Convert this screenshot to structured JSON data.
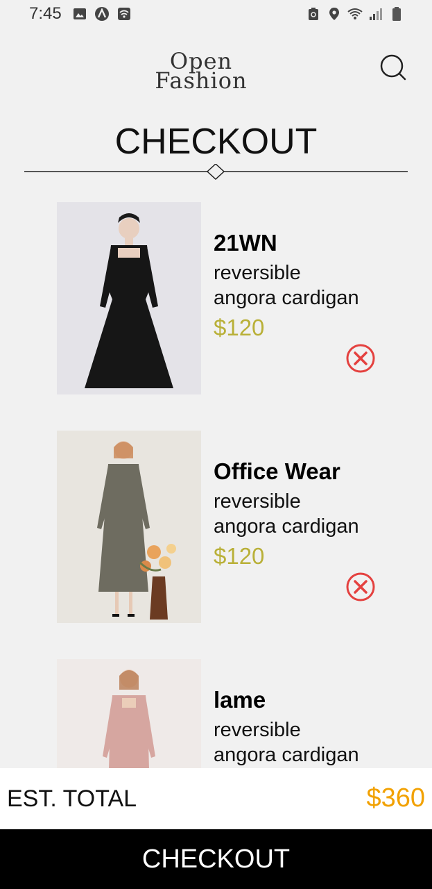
{
  "status_bar": {
    "time": "7:45",
    "left_icons": [
      "image-icon",
      "a-circle-icon",
      "wifi-box-icon"
    ],
    "right_icons": [
      "recycle-icon",
      "location-icon",
      "wifi-icon",
      "signal-icon",
      "battery-icon"
    ]
  },
  "header": {
    "logo_line1": "Open",
    "logo_line2": "Fashion",
    "search_icon": "search-icon"
  },
  "page": {
    "title": "CHECKOUT"
  },
  "items": [
    {
      "brand": "21WN",
      "desc_line1": "reversible",
      "desc_line2": "angora cardigan",
      "price": "$120",
      "remove_icon": "close-circle-icon",
      "dress_color": "#161616",
      "bg_color": "#e4e3e8"
    },
    {
      "brand": "Office Wear",
      "desc_line1": "reversible",
      "desc_line2": "angora cardigan",
      "price": "$120",
      "remove_icon": "close-circle-icon",
      "dress_color": "#6e6c60",
      "bg_color": "#e8e5df"
    },
    {
      "brand": "lame",
      "desc_line1": "reversible",
      "desc_line2": "angora cardigan",
      "price": "",
      "remove_icon": "close-circle-icon",
      "dress_color": "#d6a6a0",
      "bg_color": "#efeae8"
    }
  ],
  "total": {
    "label": "EST. TOTAL",
    "value": "$360"
  },
  "checkout_button": {
    "label": "CHECKOUT"
  },
  "colors": {
    "background": "#f1f1f1",
    "price": "#b9b038",
    "total": "#f2a100",
    "remove": "#e4413f",
    "button_bg": "#000000"
  }
}
